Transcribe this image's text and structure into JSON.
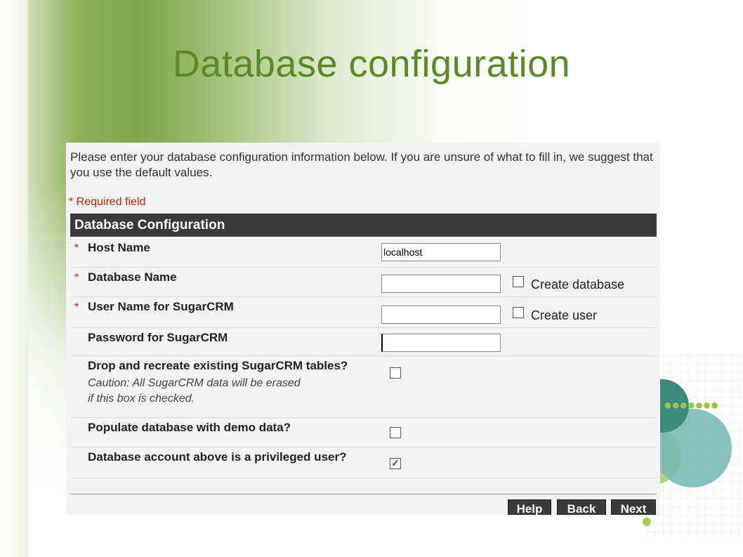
{
  "slide": {
    "title": "Database configuration"
  },
  "panel": {
    "intro": "Please enter your database configuration information below. If you are unsure of what to fill in, we suggest that you use the default values.",
    "required_note": "* Required field",
    "section_title": "Database Configuration",
    "required_star": "*",
    "fields": {
      "host_name": {
        "label": "Host Name",
        "value": "localhost"
      },
      "database_name": {
        "label": "Database Name",
        "value": "",
        "checkbox_label": "Create database",
        "checked": false
      },
      "user_name": {
        "label": "User Name for SugarCRM",
        "value": "",
        "checkbox_label": "Create user",
        "checked": false
      },
      "password": {
        "label": "Password for SugarCRM",
        "value": ""
      },
      "drop_tables": {
        "label": "Drop and recreate existing SugarCRM tables?",
        "caution_line1": "Caution: All SugarCRM data will be erased",
        "caution_line2": "if this box is checked.",
        "checked": false
      },
      "demo_data": {
        "label": "Populate database with demo data?",
        "checked": false
      },
      "privileged": {
        "label": "Database account above is a privileged user?",
        "checked": true,
        "check_mark": "✓"
      }
    },
    "buttons": {
      "help": "Help",
      "back": "Back",
      "next": "Next"
    }
  },
  "colors": {
    "title_green": "#5a8a25",
    "header_bg": "#3a3a3a",
    "required_red": "#cc2200"
  }
}
